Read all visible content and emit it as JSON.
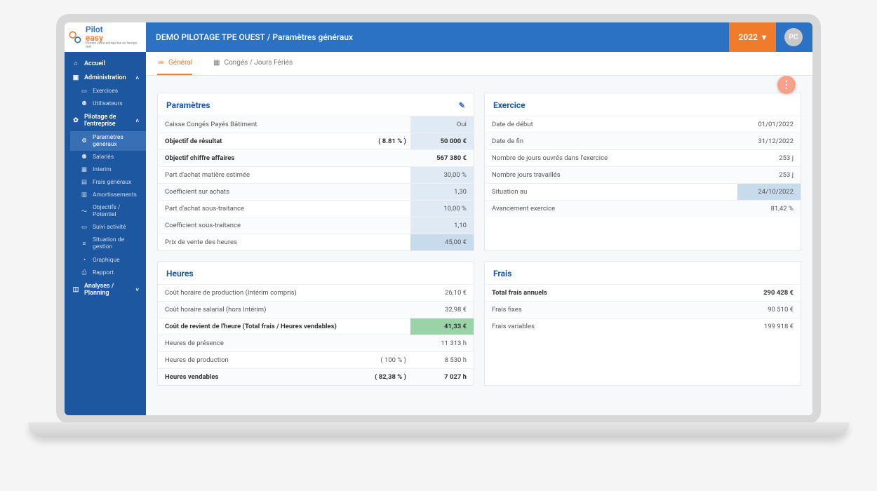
{
  "logo": {
    "brand_blue": "Pilot",
    "brand_orange": "easy",
    "tagline": "Pilotez votre entreprise en temps réel"
  },
  "topbar": {
    "title": "DEMO PILOTAGE TPE OUEST / Paramètres généraux",
    "year": "2022",
    "avatar": "PC"
  },
  "nav": {
    "accueil": "Accueil",
    "admin": "Administration",
    "admin_items": {
      "exercices": "Exercices",
      "utilisateurs": "Utilisateurs"
    },
    "pilotage": "Pilotage de l'entreprise",
    "pilotage_items": {
      "params": "Paramètres généraux",
      "salaries": "Salariés",
      "interim": "Interim",
      "frais": "Frais généraux",
      "amort": "Amortissements",
      "objectifs": "Objectifs / Potentiel",
      "suivi": "Suivi activité",
      "situation": "Situation de gestion",
      "graphique": "Graphique",
      "rapport": "Rapport"
    },
    "analyses": "Analyses / Planning"
  },
  "tabs": {
    "general": "Général",
    "conges": "Congés / Jours Fériés"
  },
  "parametres": {
    "title": "Paramètres",
    "r0": {
      "l": "Caisse Congés Payés Bâtiment",
      "v": "Oui"
    },
    "r1": {
      "l": "Objectif de résultat",
      "m": "( 8.81 % )",
      "v": "50 000 €"
    },
    "r2": {
      "l": "Objectif chiffre affaires",
      "v": "567 380 €"
    },
    "r3": {
      "l": "Part d'achat matière estimée",
      "v": "30,00 %"
    },
    "r4": {
      "l": "Coefficient sur achats",
      "v": "1,30"
    },
    "r5": {
      "l": "Part d'achat sous-traitance",
      "v": "10,00 %"
    },
    "r6": {
      "l": "Coefficient sous-traitance",
      "v": "1,10"
    },
    "r7": {
      "l": "Prix de vente des heures",
      "v": "45,00 €"
    }
  },
  "exercice": {
    "title": "Exercice",
    "r0": {
      "l": "Date de début",
      "v": "01/01/2022"
    },
    "r1": {
      "l": "Date de fin",
      "v": "31/12/2022"
    },
    "r2": {
      "l": "Nombre de jours ouvrés dans l'exercice",
      "v": "253 j"
    },
    "r3": {
      "l": "Nombre jours travaillés",
      "v": "253 j"
    },
    "r4": {
      "l": "Situation au",
      "v": "24/10/2022"
    },
    "r5": {
      "l": "Avancement exercice",
      "v": "81,42 %"
    }
  },
  "heures": {
    "title": "Heures",
    "r0": {
      "l": "Coût horaire de production (Intérim compris)",
      "v": "26,10 €"
    },
    "r1": {
      "l": "Coût horaire salarial (hors Intérim)",
      "v": "32,98 €"
    },
    "r2": {
      "l": "Coût de revient de l'heure (Total frais / Heures vendables)",
      "v": "41,33 €"
    },
    "r3": {
      "l": "Heures de présence",
      "v": "11 313 h"
    },
    "r4": {
      "l": "Heures de production",
      "m": "( 100 % )",
      "v": "8 530 h"
    },
    "r5": {
      "l": "Heures vendables",
      "m": "( 82,38 % )",
      "v": "7 027 h"
    }
  },
  "frais": {
    "title": "Frais",
    "r0": {
      "l": "Total frais annuels",
      "v": "290 428 €"
    },
    "r1": {
      "l": "Frais fixes",
      "v": "90 510 €"
    },
    "r2": {
      "l": "Frais variables",
      "v": "199 918 €"
    }
  }
}
